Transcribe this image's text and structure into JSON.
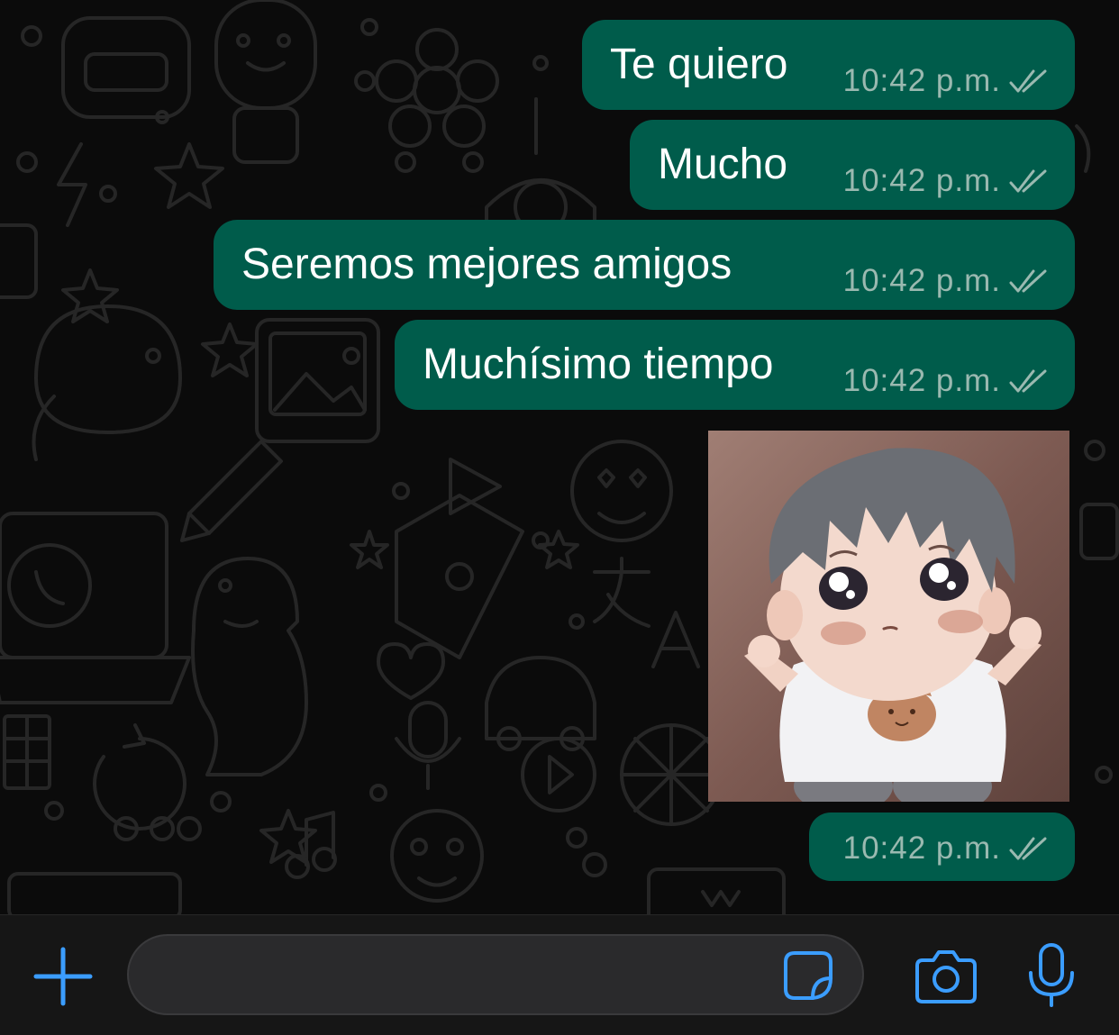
{
  "messages": [
    {
      "text": "Te quiero",
      "time": "10:42 p.m.",
      "status": "read"
    },
    {
      "text": "Mucho",
      "time": "10:42 p.m.",
      "status": "read"
    },
    {
      "text": "Seremos mejores amigos",
      "time": "10:42 p.m.",
      "status": "read"
    },
    {
      "text": "Muchísimo tiempo",
      "time": "10:42 p.m.",
      "status": "read"
    }
  ],
  "image_message": {
    "description_icon": "anime-baby-sticker",
    "time": "10:42 p.m.",
    "status": "read"
  },
  "composer": {
    "placeholder": "",
    "value": "",
    "icons": [
      "plus-icon",
      "sticker-icon",
      "camera-icon",
      "microphone-icon"
    ]
  },
  "colors": {
    "background": "#0b0b0b",
    "outgoing_bubble": "#005c4b",
    "meta_text": "#9ab9b0",
    "accent_blue": "#3b9dff",
    "input_bar": "#161616"
  }
}
